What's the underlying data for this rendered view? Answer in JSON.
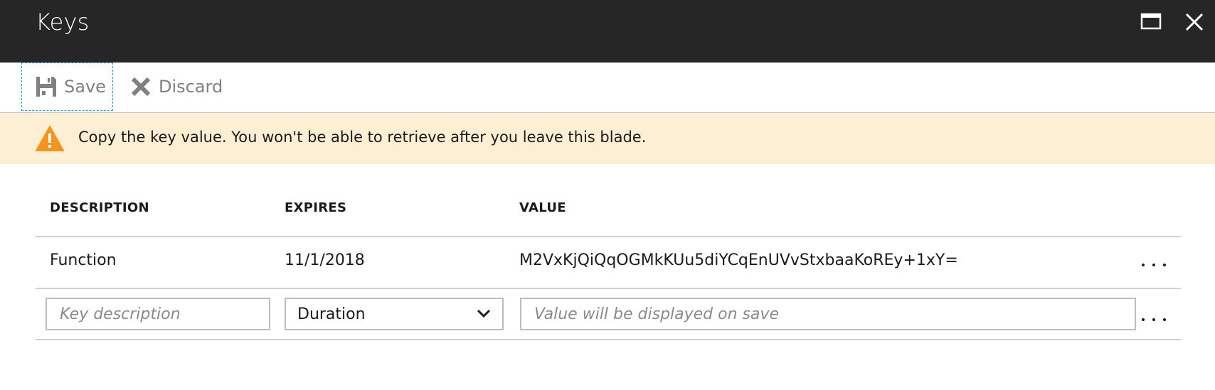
{
  "window": {
    "title": "Keys",
    "maximize_icon": "maximize-icon",
    "close_icon": "close-icon"
  },
  "toolbar": {
    "save_label": "Save",
    "save_icon": "floppy-disk-icon",
    "discard_label": "Discard",
    "discard_icon": "x-icon"
  },
  "banner": {
    "icon": "warning-triangle-icon",
    "message": "Copy the key value. You won't be able to retrieve after you leave this blade.",
    "background": "#fdefd3",
    "icon_color": "#f7941d"
  },
  "table": {
    "headers": [
      "DESCRIPTION",
      "EXPIRES",
      "VALUE"
    ],
    "rows": [
      {
        "description": "Function",
        "expires": "11/1/2018",
        "value": "M2VxKjQiQqOGMkKUu5diYCqEnUVvStxbaaKoREy+1xY="
      }
    ],
    "new_row": {
      "description_placeholder": "Key description",
      "description_value": "",
      "expires_selected": "Duration",
      "value_placeholder": "Value will be displayed on save",
      "value_value": ""
    }
  },
  "colors": {
    "titlebar": "#262626",
    "focus_outline": "#1aa0d8"
  }
}
